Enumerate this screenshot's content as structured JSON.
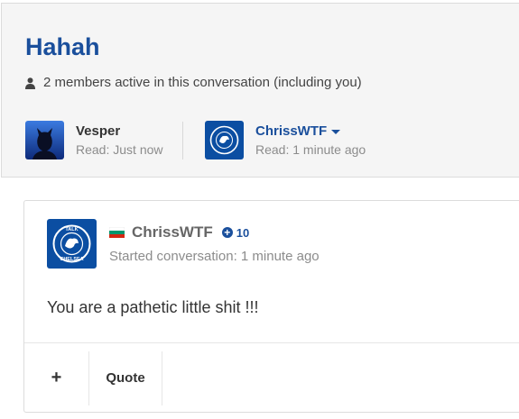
{
  "conversation": {
    "title": "Hahah",
    "members_text": "2 members active in this conversation (including you)"
  },
  "participants": [
    {
      "name": "Vesper",
      "read": "Read: Just now",
      "avatar_icon": "silhouette-avatar-icon"
    },
    {
      "name": "ChrissWTF",
      "read": "Read: 1 minute ago",
      "avatar_icon": "talk-chelsea-logo"
    }
  ],
  "message": {
    "author": "ChrissWTF",
    "reputation": "10",
    "started": "Started conversation: 1 minute ago",
    "body": "You are a pathetic little shit !!!",
    "logo_text": [
      "TALK",
      "CHELSEA"
    ]
  },
  "actions": {
    "plus_label": "+",
    "quote_label": "Quote"
  },
  "colors": {
    "accent": "#1a4f9c",
    "panel_bg": "#f5f5f5"
  }
}
